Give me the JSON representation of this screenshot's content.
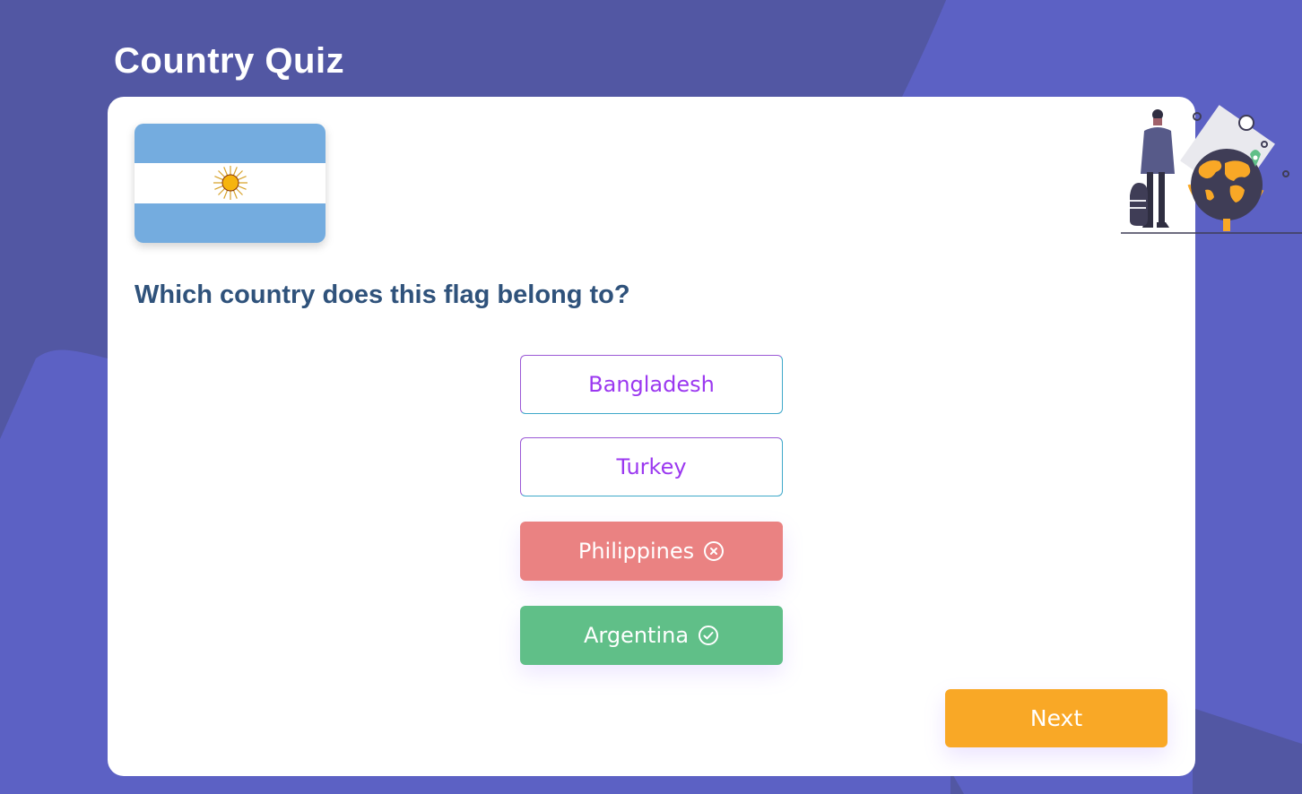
{
  "app": {
    "title": "Country Quiz"
  },
  "quiz": {
    "flag_icon": "argentina-flag",
    "question": "Which country does this flag belong to?",
    "options": [
      {
        "label": "Bangladesh",
        "state": "neutral"
      },
      {
        "label": "Turkey",
        "state": "neutral"
      },
      {
        "label": "Philippines",
        "state": "wrong",
        "icon": "x-circle-icon"
      },
      {
        "label": "Argentina",
        "state": "correct",
        "icon": "check-circle-icon"
      }
    ],
    "next_label": "Next"
  },
  "colors": {
    "background": "#5c61c4",
    "card": "#ffffff",
    "question_text": "#2f527b",
    "option_text": "#9b38f0",
    "wrong": "#ea8282",
    "correct": "#60bf88",
    "next": "#f9a826"
  }
}
